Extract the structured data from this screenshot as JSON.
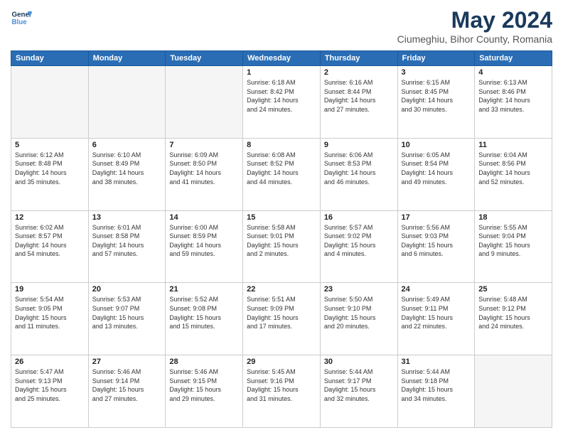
{
  "header": {
    "logo_line1": "General",
    "logo_line2": "Blue",
    "month_title": "May 2024",
    "subtitle": "Ciumeghiu, Bihor County, Romania"
  },
  "days_of_week": [
    "Sunday",
    "Monday",
    "Tuesday",
    "Wednesday",
    "Thursday",
    "Friday",
    "Saturday"
  ],
  "weeks": [
    [
      {
        "day": "",
        "info": ""
      },
      {
        "day": "",
        "info": ""
      },
      {
        "day": "",
        "info": ""
      },
      {
        "day": "1",
        "info": "Sunrise: 6:18 AM\nSunset: 8:42 PM\nDaylight: 14 hours\nand 24 minutes."
      },
      {
        "day": "2",
        "info": "Sunrise: 6:16 AM\nSunset: 8:44 PM\nDaylight: 14 hours\nand 27 minutes."
      },
      {
        "day": "3",
        "info": "Sunrise: 6:15 AM\nSunset: 8:45 PM\nDaylight: 14 hours\nand 30 minutes."
      },
      {
        "day": "4",
        "info": "Sunrise: 6:13 AM\nSunset: 8:46 PM\nDaylight: 14 hours\nand 33 minutes."
      }
    ],
    [
      {
        "day": "5",
        "info": "Sunrise: 6:12 AM\nSunset: 8:48 PM\nDaylight: 14 hours\nand 35 minutes."
      },
      {
        "day": "6",
        "info": "Sunrise: 6:10 AM\nSunset: 8:49 PM\nDaylight: 14 hours\nand 38 minutes."
      },
      {
        "day": "7",
        "info": "Sunrise: 6:09 AM\nSunset: 8:50 PM\nDaylight: 14 hours\nand 41 minutes."
      },
      {
        "day": "8",
        "info": "Sunrise: 6:08 AM\nSunset: 8:52 PM\nDaylight: 14 hours\nand 44 minutes."
      },
      {
        "day": "9",
        "info": "Sunrise: 6:06 AM\nSunset: 8:53 PM\nDaylight: 14 hours\nand 46 minutes."
      },
      {
        "day": "10",
        "info": "Sunrise: 6:05 AM\nSunset: 8:54 PM\nDaylight: 14 hours\nand 49 minutes."
      },
      {
        "day": "11",
        "info": "Sunrise: 6:04 AM\nSunset: 8:56 PM\nDaylight: 14 hours\nand 52 minutes."
      }
    ],
    [
      {
        "day": "12",
        "info": "Sunrise: 6:02 AM\nSunset: 8:57 PM\nDaylight: 14 hours\nand 54 minutes."
      },
      {
        "day": "13",
        "info": "Sunrise: 6:01 AM\nSunset: 8:58 PM\nDaylight: 14 hours\nand 57 minutes."
      },
      {
        "day": "14",
        "info": "Sunrise: 6:00 AM\nSunset: 8:59 PM\nDaylight: 14 hours\nand 59 minutes."
      },
      {
        "day": "15",
        "info": "Sunrise: 5:58 AM\nSunset: 9:01 PM\nDaylight: 15 hours\nand 2 minutes."
      },
      {
        "day": "16",
        "info": "Sunrise: 5:57 AM\nSunset: 9:02 PM\nDaylight: 15 hours\nand 4 minutes."
      },
      {
        "day": "17",
        "info": "Sunrise: 5:56 AM\nSunset: 9:03 PM\nDaylight: 15 hours\nand 6 minutes."
      },
      {
        "day": "18",
        "info": "Sunrise: 5:55 AM\nSunset: 9:04 PM\nDaylight: 15 hours\nand 9 minutes."
      }
    ],
    [
      {
        "day": "19",
        "info": "Sunrise: 5:54 AM\nSunset: 9:05 PM\nDaylight: 15 hours\nand 11 minutes."
      },
      {
        "day": "20",
        "info": "Sunrise: 5:53 AM\nSunset: 9:07 PM\nDaylight: 15 hours\nand 13 minutes."
      },
      {
        "day": "21",
        "info": "Sunrise: 5:52 AM\nSunset: 9:08 PM\nDaylight: 15 hours\nand 15 minutes."
      },
      {
        "day": "22",
        "info": "Sunrise: 5:51 AM\nSunset: 9:09 PM\nDaylight: 15 hours\nand 17 minutes."
      },
      {
        "day": "23",
        "info": "Sunrise: 5:50 AM\nSunset: 9:10 PM\nDaylight: 15 hours\nand 20 minutes."
      },
      {
        "day": "24",
        "info": "Sunrise: 5:49 AM\nSunset: 9:11 PM\nDaylight: 15 hours\nand 22 minutes."
      },
      {
        "day": "25",
        "info": "Sunrise: 5:48 AM\nSunset: 9:12 PM\nDaylight: 15 hours\nand 24 minutes."
      }
    ],
    [
      {
        "day": "26",
        "info": "Sunrise: 5:47 AM\nSunset: 9:13 PM\nDaylight: 15 hours\nand 25 minutes."
      },
      {
        "day": "27",
        "info": "Sunrise: 5:46 AM\nSunset: 9:14 PM\nDaylight: 15 hours\nand 27 minutes."
      },
      {
        "day": "28",
        "info": "Sunrise: 5:46 AM\nSunset: 9:15 PM\nDaylight: 15 hours\nand 29 minutes."
      },
      {
        "day": "29",
        "info": "Sunrise: 5:45 AM\nSunset: 9:16 PM\nDaylight: 15 hours\nand 31 minutes."
      },
      {
        "day": "30",
        "info": "Sunrise: 5:44 AM\nSunset: 9:17 PM\nDaylight: 15 hours\nand 32 minutes."
      },
      {
        "day": "31",
        "info": "Sunrise: 5:44 AM\nSunset: 9:18 PM\nDaylight: 15 hours\nand 34 minutes."
      },
      {
        "day": "",
        "info": ""
      }
    ]
  ]
}
